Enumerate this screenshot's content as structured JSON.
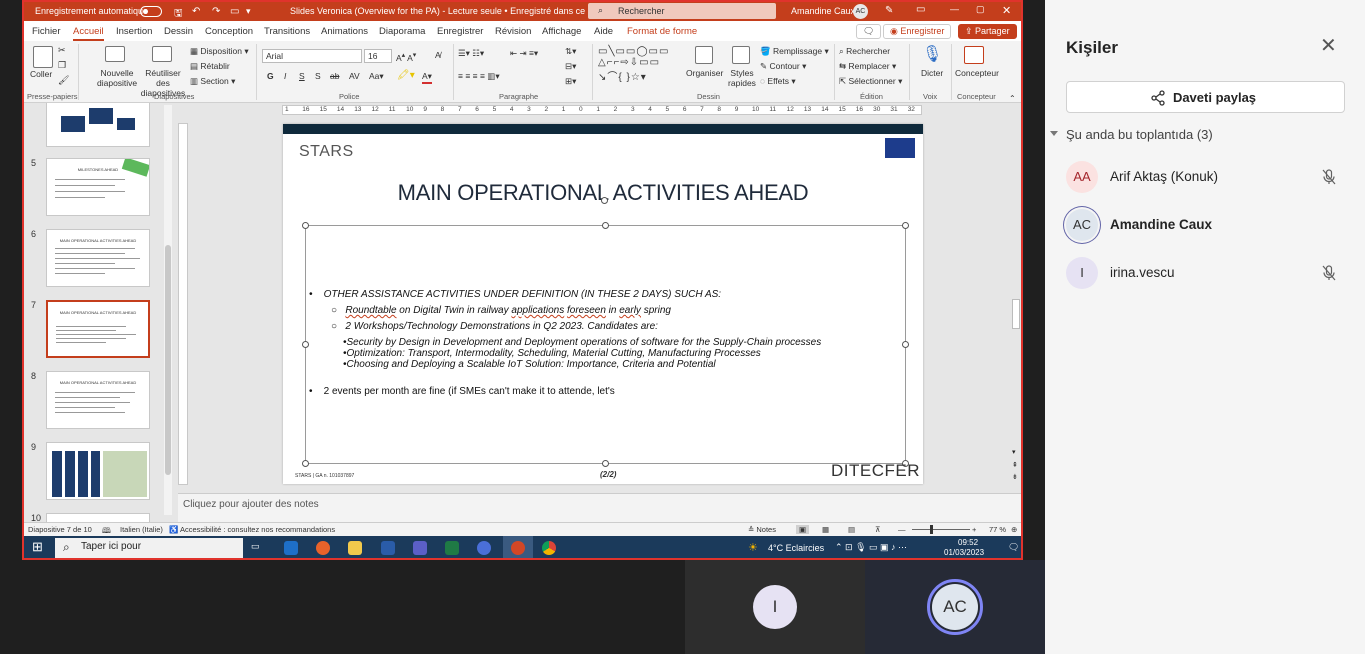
{
  "window": {
    "autosave_label": "Enregistrement automatique",
    "doc_title": "Slides Veronica (Overview for the PA)  -  Lecture seule  •  Enregistré dans ce PC",
    "search_placeholder": "Rechercher",
    "user_name": "Amandine Caux",
    "user_initials": "AC"
  },
  "tabs": [
    "Fichier",
    "Accueil",
    "Insertion",
    "Dessin",
    "Conception",
    "Transitions",
    "Animations",
    "Diaporama",
    "Enregistrer",
    "Révision",
    "Affichage",
    "Aide",
    "Format de forme"
  ],
  "tab_actions": {
    "record": "Enregistrer",
    "share": "Partager"
  },
  "ribbon": {
    "paste": "Coller",
    "new_slide": "Nouvelle diapositive",
    "reuse": "Réutiliser des diapositives",
    "layout": "Disposition",
    "reset": "Rétablir",
    "section": "Section",
    "font_name": "Arial",
    "font_size": "16",
    "arrange": "Organiser",
    "styles": "Styles rapides",
    "fill": "Remplissage",
    "outline": "Contour",
    "effects": "Effets",
    "find": "Rechercher",
    "replace": "Remplacer",
    "select": "Sélectionner",
    "dictate": "Dicter",
    "designer": "Concepteur",
    "groups": {
      "clipboard": "Presse-papiers",
      "slides": "Diapositives",
      "font": "Police",
      "paragraph": "Paragraphe",
      "drawing": "Dessin",
      "editing": "Édition",
      "voice": "Voix",
      "designer": "Concepteur"
    }
  },
  "ruler_labels": [
    "1",
    "16",
    "15",
    "14",
    "13",
    "12",
    "11",
    "10",
    "9",
    "8",
    "7",
    "6",
    "5",
    "4",
    "3",
    "2",
    "1",
    "0",
    "1",
    "2",
    "3",
    "4",
    "5",
    "6",
    "7",
    "8",
    "9",
    "10",
    "11",
    "12",
    "13",
    "14",
    "15",
    "16",
    "30",
    "31",
    "32"
  ],
  "thumbnails": [
    {
      "num": "5",
      "title": "MILESTONES AHEAD"
    },
    {
      "num": "6",
      "title": "MAIN OPERATIONAL ACTIVITIES AHEAD"
    },
    {
      "num": "7",
      "title": "MAIN OPERATIONAL ACTIVITIES AHEAD"
    },
    {
      "num": "8",
      "title": "MAIN OPERATIONAL ACTIVITIES AHEAD"
    },
    {
      "num": "9",
      "title": ""
    },
    {
      "num": "10",
      "title": ""
    }
  ],
  "slide": {
    "logo": "STARS",
    "title": "MAIN OPERATIONAL ACTIVITIES AHEAD",
    "bullet1": "OTHER ASSISTANCE ACTIVITIES UNDER DEFINITION (IN THESE 2 DAYS) SUCH AS:",
    "sub1": [
      "Roundtable",
      " on Digital Twin in railway ",
      "applications",
      " ",
      "foreseen",
      " in ",
      "early",
      " spring"
    ],
    "sub2": "2 Workshops/Technology Demonstrations in Q2 2023. Candidates are:",
    "sub3": [
      "Security by Design in Development and Deployment operations of software for the Supply-Chain processes",
      "Optimization: Transport, Intermodality, Scheduling, Material Cutting, Manufacturing Processes",
      "Choosing and Deploying a Scalable IoT Solution: Importance, Criteria and Potential"
    ],
    "bullet2": "2 events per month are fine (if SMEs can't make it to attende, let's",
    "footer_left": "STARS | GA n. 101037897",
    "footer_center": "(2/2)",
    "footer_logo": "DITECFER"
  },
  "notes_placeholder": "Cliquez pour ajouter des notes",
  "statusbar": {
    "slide_count": "Diapositive 7 de 10",
    "language": "Italien (Italie)",
    "accessibility": "Accessibilité : consultez nos recommandations",
    "notes": "Notes",
    "zoom": "77 %"
  },
  "taskbar": {
    "search": "Taper ici pour",
    "weather": "4°C  Eclaircies",
    "time": "09:52",
    "date": "01/03/2023"
  },
  "people_panel": {
    "title": "Kişiler",
    "invite": "Daveti paylaş",
    "section": "Şu anda bu toplantıda (3)",
    "participants": [
      {
        "initials": "AA",
        "name": "Arif Aktaş (Konuk)",
        "muted": true,
        "avatar_bg": "#fbe2e1",
        "avatar_fg": "#a4262c"
      },
      {
        "initials": "AC",
        "name": "Amandine Caux",
        "muted": false,
        "avatar_bg": "#dfe6ee",
        "avatar_fg": "#333333"
      },
      {
        "initials": "I",
        "name": "irina.vescu",
        "muted": true,
        "avatar_bg": "#e6e2f3",
        "avatar_fg": "#333333"
      }
    ]
  },
  "video_tiles": [
    {
      "initials": "I"
    },
    {
      "initials": "AC"
    }
  ],
  "colors": {
    "ppt_accent": "#c43e1c",
    "share_border": "#e0332c",
    "teams_accent": "#6264a7"
  }
}
